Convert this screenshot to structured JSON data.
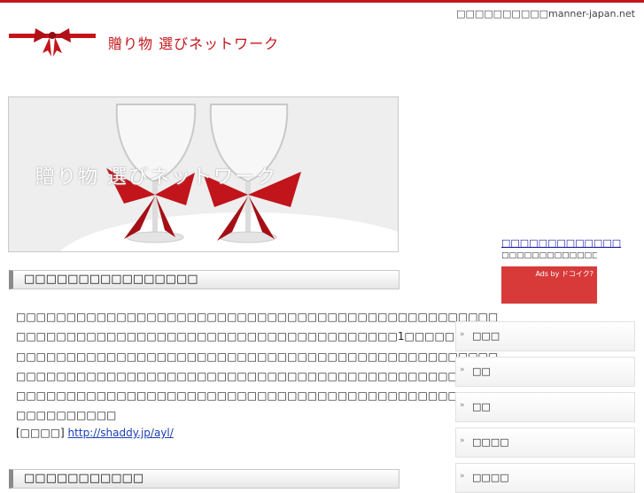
{
  "header": {
    "site_text": "□□□□□□□□□□manner-japan.net",
    "logo_text": "贈り物 選びネットワーク"
  },
  "hero": {
    "caption": "贈り物 選びネットワーク"
  },
  "sections": [
    {
      "title": "□□□□□□□□□□□□□□□□"
    },
    {
      "title": "□□□□□□□□□□□"
    }
  ],
  "article": {
    "lines": [
      "□□□□□□□□□□□□□□□□□□□□□□□□□□□□□□□□□□□□□□□□□□□□□□□□",
      "□□□□□□□□□□□□□□□□□□□□□□□□□□□□□□□□□□□□□□1□□□□□□□□□□",
      "□□□□□□□□□□□□□□□□□□□□□□□□□□□□□□□□□□□□□□□□□□□□□□□□",
      "□□□□□□□□□□□□□□□□□□□□□□□□□□□□□□□□□□□□□□□□□□□□□□□□",
      "□□□□□□□□□□□□□□□□□□□□□□□□□□□□□□□□□□□□□□□□□□□□□□□□",
      "□□□□□□□□□□"
    ],
    "ref_label": "[□□□□]",
    "ref_link": "http://shaddy.jp/ayl/"
  },
  "ad": {
    "title": "□□□□□□□□□□□□□",
    "desc": "□□□□□□□□□□□□□□□□□□□□□□□□□□",
    "label": "Ads by ドコイク?"
  },
  "categories": [
    {
      "label": "□□□"
    },
    {
      "label": "□□"
    },
    {
      "label": "□□"
    },
    {
      "label": "□□□□"
    },
    {
      "label": "□□□□"
    }
  ],
  "colors": {
    "accent": "#c4141b",
    "link": "#1a3fb5"
  }
}
